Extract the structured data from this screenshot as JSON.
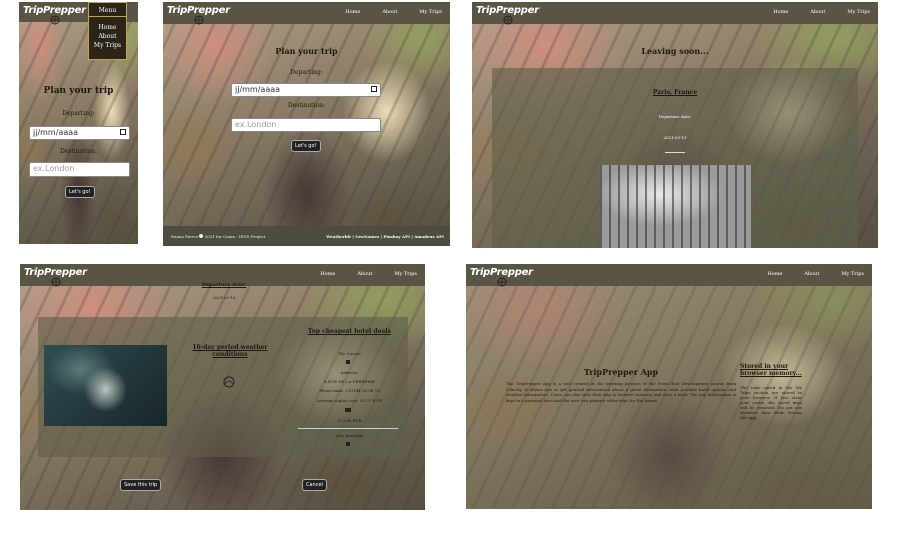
{
  "brand": {
    "logo_text": "TripPrepper"
  },
  "nav": {
    "home": "Home",
    "about": "About",
    "trips": "My Trips",
    "menu": "Menu"
  },
  "plan": {
    "title": "Plan your trip",
    "departing_label": "Departing:",
    "date_value": "jj/mm/aaaa",
    "destination_label": "Destination:",
    "destination_placeholder": "ex.London",
    "go_button": "Let's go!"
  },
  "footer": {
    "left_text": "Emma Pierce",
    "left_suffix": "2021 for Cnam - IENS Project",
    "apis": "Weatherbit | GeoNames | Pixabay API | Amadeus API"
  },
  "leaving": {
    "title": "Leaving soon...",
    "city": "Paris, France",
    "departure_label": "Departure date:",
    "departure_date": "2021-03-13"
  },
  "details": {
    "departure_label": "Departure date:",
    "departure_date": "2021-03-19",
    "weather_title": "16-day period weather conditions",
    "hotels_title": "Top cheapest hotel deals",
    "hotel_name": "The Corner",
    "address_label": "Address:",
    "address_line": "8 RUE DE LA VERRERIE",
    "phone": "Phone num: +33144 39 08 73",
    "price_line": "Average nights cost: 51.07 EUR",
    "price": "123.36 EUR",
    "more_label": "Also available",
    "save_button": "Save this trip",
    "cancel_button": "Cancel"
  },
  "about": {
    "title": "TripPrepper App",
    "body": "The TripPrepper App is a tool created at the learning process of the Front End Development course from Udacity. It allows you to get general information about a given destination, with possible hotel options and weather information. Users can also save their trip to browser memory and view it later. The trip information is kept in a personal area and the user can prepare other trips for the future.",
    "side_title": "Stored in your browser memory...",
    "side_body": "The trips saved in the My Trips section are stored in your browser. If you clear your cache, the saved trips will be removed. Do not use sensitive data while testing this app."
  },
  "colors": {
    "navbar": "#5a5444",
    "veil": "rgba(95,95,75,0.62)",
    "button": "#222222"
  }
}
